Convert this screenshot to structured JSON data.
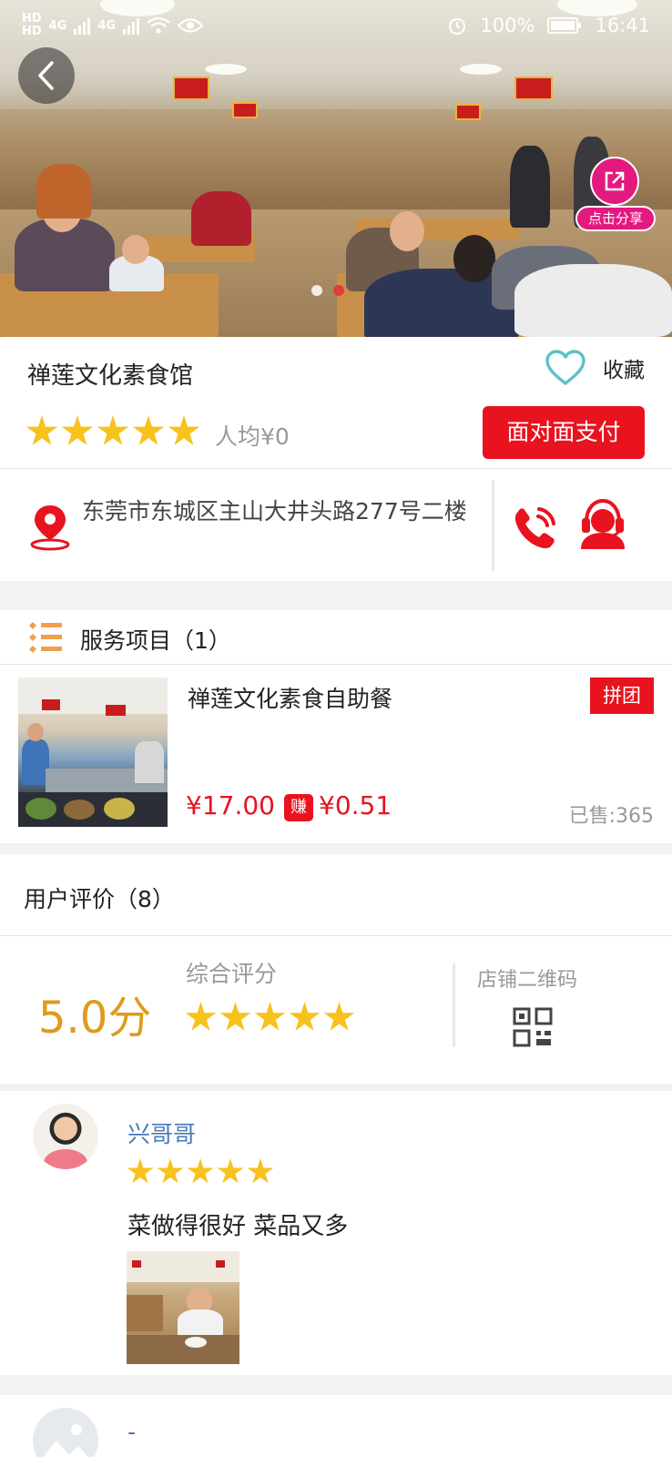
{
  "status_bar": {
    "network_left": "HD",
    "network_left_2": "HD",
    "signal_1": "4G",
    "signal_2": "4G",
    "battery": "100%",
    "time": "16:41"
  },
  "hero": {
    "share_label": "点击分享",
    "carousel_count": 2,
    "carousel_active": 2
  },
  "shop": {
    "name": "禅莲文化素食馆",
    "favorite_label": "收藏",
    "rating_stars": 5,
    "avg_price": "人均¥0",
    "pay_button": "面对面支付",
    "address": "东莞市东城区主山大井头路277号二楼"
  },
  "services": {
    "header": "服务项目（1）",
    "items": [
      {
        "name": "禅莲文化素食自助餐",
        "badge": "拼团",
        "price": "¥17.00",
        "earn_badge": "赚",
        "earn_amount": "¥0.51",
        "sold": "已售:365"
      }
    ]
  },
  "reviews": {
    "header": "用户评价（8）",
    "score": "5.0分",
    "score_label": "综合评分",
    "overall_stars": 5,
    "qr_label": "店铺二维码",
    "items": [
      {
        "user": "兴哥哥",
        "stars": 5,
        "text": "菜做得很好 菜品又多"
      },
      {
        "user": "-"
      }
    ]
  },
  "colors": {
    "primary_red": "#e8131f",
    "star_yellow": "#f7c21c",
    "score_orange": "#e09a1b",
    "share_magenta": "#e4197f",
    "heart_teal": "#5cc2c6",
    "user_blue": "#4a7ab5"
  },
  "icons": {
    "back": "chevron-left-icon",
    "share": "external-link-icon",
    "favorite": "heart-outline-icon",
    "location": "map-pin-icon",
    "phone": "phone-ringing-icon",
    "service": "customer-service-icon",
    "list": "list-icon",
    "qr": "qr-code-icon"
  }
}
